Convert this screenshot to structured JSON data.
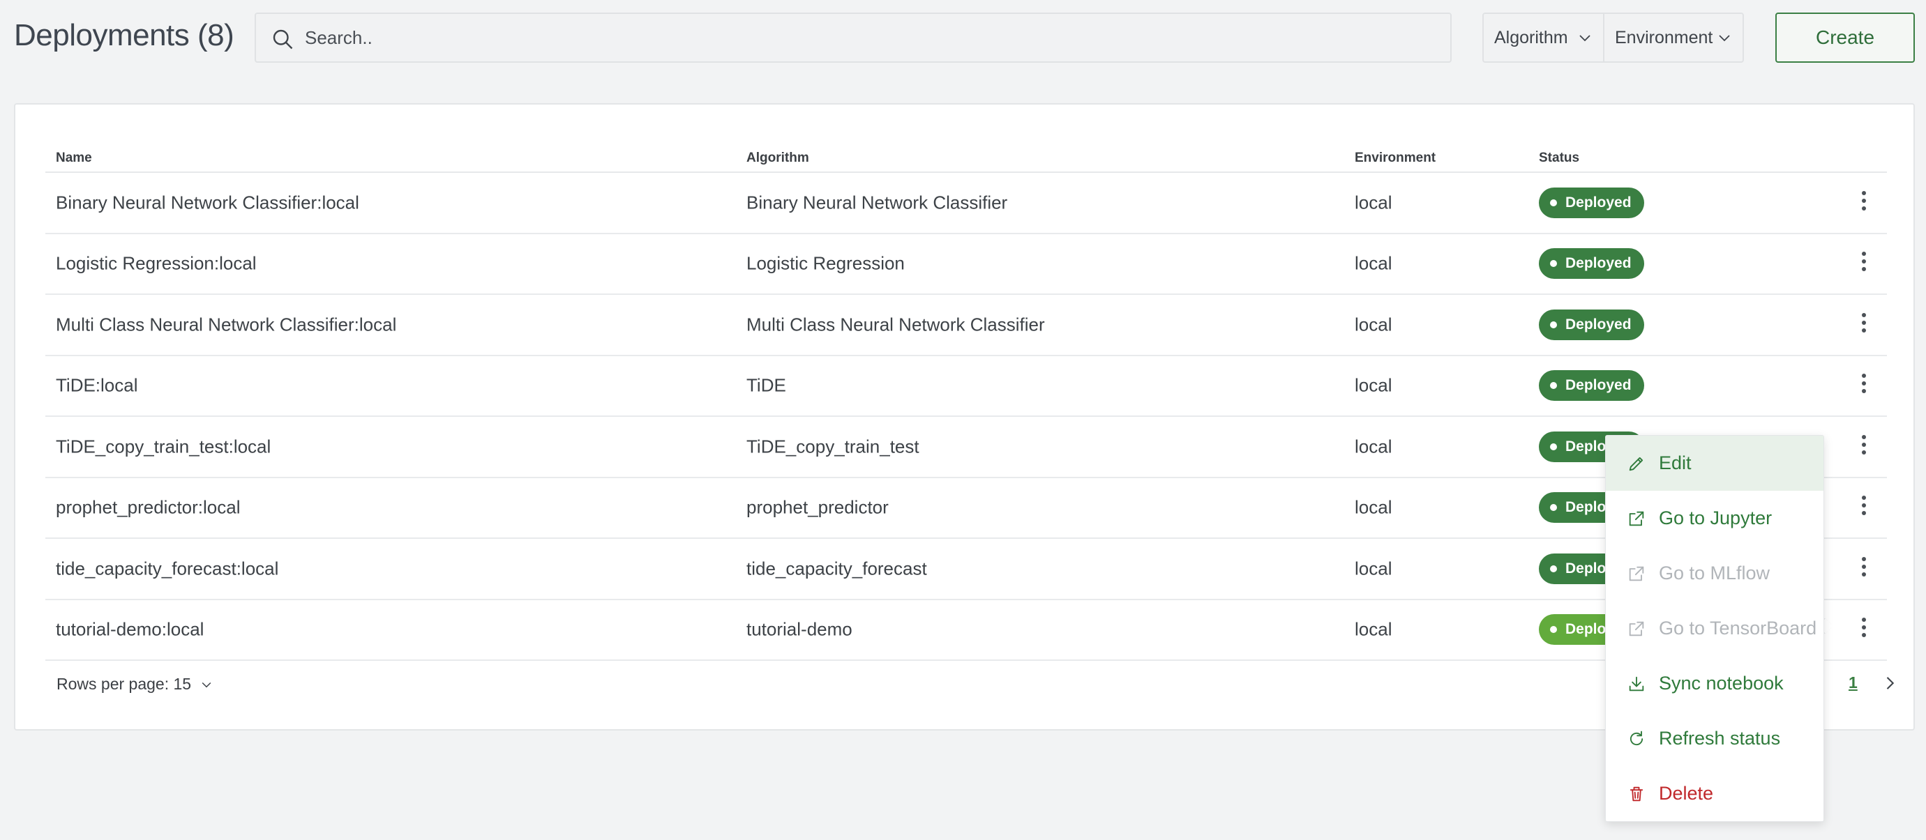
{
  "header": {
    "title": "Deployments (8)",
    "search_placeholder": "Search..",
    "filters": {
      "algorithm": "Algorithm",
      "environment": "Environment"
    },
    "create_label": "Create"
  },
  "table": {
    "columns": {
      "name": "Name",
      "algorithm": "Algorithm",
      "environment": "Environment",
      "status": "Status"
    },
    "rows": [
      {
        "name": "Binary Neural Network Classifier:local",
        "algorithm": "Binary Neural Network Classifier",
        "environment": "local",
        "status": "Deployed"
      },
      {
        "name": "Logistic Regression:local",
        "algorithm": "Logistic Regression",
        "environment": "local",
        "status": "Deployed"
      },
      {
        "name": "Multi Class Neural Network Classifier:local",
        "algorithm": "Multi Class Neural Network Classifier",
        "environment": "local",
        "status": "Deployed"
      },
      {
        "name": "TiDE:local",
        "algorithm": "TiDE",
        "environment": "local",
        "status": "Deployed"
      },
      {
        "name": "TiDE_copy_train_test:local",
        "algorithm": "TiDE_copy_train_test",
        "environment": "local",
        "status": "Deployed"
      },
      {
        "name": "prophet_predictor:local",
        "algorithm": "prophet_predictor",
        "environment": "local",
        "status": "Deployed"
      },
      {
        "name": "tide_capacity_forecast:local",
        "algorithm": "tide_capacity_forecast",
        "environment": "local",
        "status": "Deployed"
      },
      {
        "name": "tutorial-demo:local",
        "algorithm": "tutorial-demo",
        "environment": "local",
        "status": "Deployed"
      }
    ]
  },
  "footer": {
    "rows_per_page": "Rows per page: 15",
    "current_page": "1"
  },
  "menu": {
    "items": [
      {
        "label": "Edit",
        "icon": "pencil-icon",
        "state": "active"
      },
      {
        "label": "Go to Jupyter",
        "icon": "external-link-icon",
        "state": "enabled"
      },
      {
        "label": "Go to MLflow",
        "icon": "external-link-icon",
        "state": "disabled"
      },
      {
        "label": "Go to TensorBoard",
        "icon": "external-link-icon",
        "state": "disabled"
      },
      {
        "label": "Sync notebook",
        "icon": "download-icon",
        "state": "enabled"
      },
      {
        "label": "Refresh status",
        "icon": "refresh-icon",
        "state": "enabled"
      },
      {
        "label": "Delete",
        "icon": "trash-icon",
        "state": "danger"
      }
    ]
  },
  "colors": {
    "accent": "#3a7f42",
    "status_deployed": "#3a7f42",
    "status_deployed_highlight": "#62ab3c",
    "danger": "#c0282b",
    "disabled": "#b1b5b9"
  }
}
